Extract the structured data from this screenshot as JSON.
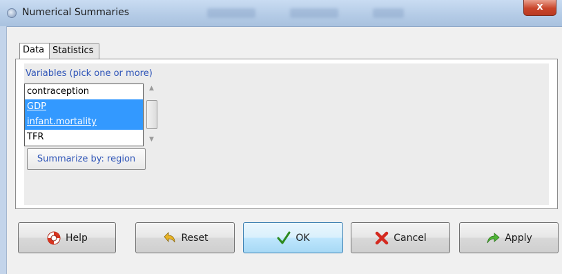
{
  "window": {
    "title": "Numerical Summaries",
    "close_glyph": "x",
    "icon": "window-icon"
  },
  "tabs": [
    {
      "label": "Data",
      "selected": true
    },
    {
      "label": "Statistics",
      "selected": false
    }
  ],
  "variables": {
    "label": "Variables (pick one or more)",
    "items": [
      {
        "label": "contraception",
        "selected": false
      },
      {
        "label": "GDP",
        "selected": true
      },
      {
        "label": "infant.mortality",
        "selected": true
      },
      {
        "label": "TFR",
        "selected": false
      }
    ]
  },
  "summarize_button": {
    "label": "Summarize by: region"
  },
  "buttons": {
    "help": {
      "label": "Help",
      "icon": "lifebuoy-icon"
    },
    "reset": {
      "label": "Reset",
      "icon": "undo-arrow-icon"
    },
    "ok": {
      "label": "OK",
      "icon": "checkmark-icon"
    },
    "cancel": {
      "label": "Cancel",
      "icon": "red-x-icon"
    },
    "apply": {
      "label": "Apply",
      "icon": "green-arrow-icon"
    }
  },
  "colors": {
    "accent_text": "#2f55b8",
    "selection": "#3399ff"
  }
}
